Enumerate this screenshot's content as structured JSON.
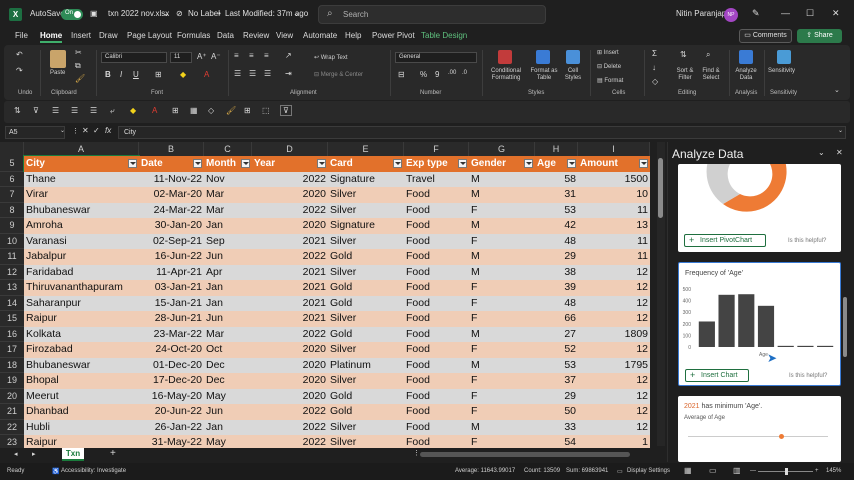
{
  "titlebar": {
    "autosave_label": "AutoSave",
    "autosave_state": "On",
    "filename": "txn 2022 nov.xlsx",
    "sensitivity": "No Label",
    "modified": "Last Modified: 37m ago",
    "search_placeholder": "Search",
    "user_name": "Nitin Paranjape",
    "user_initials": "NP"
  },
  "menu": {
    "tabs": [
      "File",
      "Home",
      "Insert",
      "Draw",
      "Page Layout",
      "Formulas",
      "Data",
      "Review",
      "View",
      "Automate",
      "Help",
      "Power Pivot",
      "Table Design"
    ],
    "active_tab": "Home",
    "comments_label": "Comments",
    "share_label": "Share"
  },
  "ribbon": {
    "groups": {
      "undo": "Undo",
      "clipboard": "Clipboard",
      "font": "Font",
      "alignment": "Alignment",
      "number": "Number",
      "styles": "Styles",
      "cells": "Cells",
      "editing": "Editing",
      "analysis": "Analysis",
      "sensitivity": "Sensitivity"
    },
    "paste_label": "Paste",
    "font_name": "Calibri",
    "font_size": "11",
    "wrap_text": "Wrap Text",
    "merge_center": "Merge & Center",
    "number_format": "General",
    "conditional_formatting": [
      "Conditional",
      "Formatting"
    ],
    "format_as_table": [
      "Format as",
      "Table"
    ],
    "cell_styles": [
      "Cell",
      "Styles"
    ],
    "insert_label": "Insert",
    "delete_label": "Delete",
    "format_label": "Format",
    "sort_filter": [
      "Sort &",
      "Filter"
    ],
    "find_select": [
      "Find &",
      "Select"
    ],
    "analyze_data": [
      "Analyze",
      "Data"
    ],
    "sensitivity_btn": "Sensitivity"
  },
  "formula_bar": {
    "name_box": "A5",
    "fx": "fx",
    "content": "City"
  },
  "grid": {
    "columns": [
      "A",
      "B",
      "C",
      "D",
      "E",
      "F",
      "G",
      "H",
      "I"
    ],
    "header_row_num": "5",
    "headers": [
      "City",
      "Date",
      "Month",
      "Year",
      "Card",
      "Exp type",
      "Gender",
      "Age",
      "Amount"
    ],
    "rows": [
      {
        "n": "6",
        "cells": [
          "Thane",
          "11-Nov-22",
          "Nov",
          "2022",
          "Signature",
          "Travel",
          "M",
          "58",
          "1500"
        ]
      },
      {
        "n": "7",
        "cells": [
          "Virar",
          "02-Mar-20",
          "Mar",
          "2020",
          "Silver",
          "Food",
          "M",
          "31",
          "10"
        ]
      },
      {
        "n": "8",
        "cells": [
          "Bhubaneswar",
          "24-Mar-22",
          "Mar",
          "2022",
          "Silver",
          "Food",
          "F",
          "53",
          "11"
        ]
      },
      {
        "n": "9",
        "cells": [
          "Amroha",
          "30-Jan-20",
          "Jan",
          "2020",
          "Signature",
          "Food",
          "M",
          "42",
          "13"
        ]
      },
      {
        "n": "10",
        "cells": [
          "Varanasi",
          "02-Sep-21",
          "Sep",
          "2021",
          "Silver",
          "Food",
          "F",
          "48",
          "11"
        ]
      },
      {
        "n": "11",
        "cells": [
          "Jabalpur",
          "16-Jun-22",
          "Jun",
          "2022",
          "Gold",
          "Food",
          "M",
          "29",
          "11"
        ]
      },
      {
        "n": "12",
        "cells": [
          "Faridabad",
          "11-Apr-21",
          "Apr",
          "2021",
          "Silver",
          "Food",
          "M",
          "38",
          "12"
        ]
      },
      {
        "n": "13",
        "cells": [
          "Thiruvananthapuram",
          "03-Jan-21",
          "Jan",
          "2021",
          "Gold",
          "Food",
          "F",
          "39",
          "12"
        ]
      },
      {
        "n": "14",
        "cells": [
          "Saharanpur",
          "15-Jan-21",
          "Jan",
          "2021",
          "Gold",
          "Food",
          "F",
          "48",
          "12"
        ]
      },
      {
        "n": "15",
        "cells": [
          "Raipur",
          "28-Jun-21",
          "Jun",
          "2021",
          "Silver",
          "Food",
          "F",
          "66",
          "12"
        ]
      },
      {
        "n": "16",
        "cells": [
          "Kolkata",
          "23-Mar-22",
          "Mar",
          "2022",
          "Gold",
          "Food",
          "M",
          "27",
          "1809"
        ]
      },
      {
        "n": "17",
        "cells": [
          "Firozabad",
          "24-Oct-20",
          "Oct",
          "2020",
          "Silver",
          "Food",
          "F",
          "52",
          "12"
        ]
      },
      {
        "n": "18",
        "cells": [
          "Bhubaneswar",
          "01-Dec-20",
          "Dec",
          "2020",
          "Platinum",
          "Food",
          "M",
          "53",
          "1795"
        ]
      },
      {
        "n": "19",
        "cells": [
          "Bhopal",
          "17-Dec-20",
          "Dec",
          "2020",
          "Silver",
          "Food",
          "F",
          "37",
          "12"
        ]
      },
      {
        "n": "20",
        "cells": [
          "Meerut",
          "16-May-20",
          "May",
          "2020",
          "Gold",
          "Food",
          "F",
          "29",
          "12"
        ]
      },
      {
        "n": "21",
        "cells": [
          "Dhanbad",
          "20-Jun-22",
          "Jun",
          "2022",
          "Gold",
          "Food",
          "F",
          "50",
          "12"
        ]
      },
      {
        "n": "22",
        "cells": [
          "Hubli",
          "26-Jan-22",
          "Jan",
          "2022",
          "Silver",
          "Food",
          "M",
          "33",
          "12"
        ]
      },
      {
        "n": "23",
        "cells": [
          "Raipur",
          "31-May-22",
          "May",
          "2022",
          "Silver",
          "Food",
          "F",
          "54",
          "1"
        ]
      }
    ],
    "colors": {
      "header": "#e2712b",
      "odd": "#d9d9d9",
      "even": "#f0cdb6"
    }
  },
  "sheet_tab": "Txn",
  "status": {
    "ready": "Ready",
    "accessibility": "Accessibility: Investigate",
    "average": "Average: 11643.99017",
    "count": "Count: 13509",
    "sum": "Sum: 69863941",
    "display_settings": "Display Settings",
    "zoom": "145%"
  },
  "pane": {
    "title": "Analyze Data",
    "card1": {
      "button": "Insert PivotChart",
      "helpful": "Is this helpful?"
    },
    "card2": {
      "title": "Frequency of 'Age'",
      "button": "Insert Chart",
      "helpful": "Is this helpful?",
      "xlabel": "Age"
    },
    "card3": {
      "title_highlight": "2021",
      "title_rest": " has minimum 'Age'.",
      "subtitle": "Average of Age"
    }
  },
  "chart_data": {
    "type": "bar",
    "title": "Frequency of 'Age'",
    "xlabel": "Age",
    "ylabel": "",
    "yticks": [
      "500",
      "400",
      "300",
      "200",
      "100",
      "0"
    ],
    "ylim": [
      0,
      500
    ],
    "values": [
      220,
      450,
      455,
      355,
      10,
      10,
      10
    ],
    "color": "#444444"
  }
}
